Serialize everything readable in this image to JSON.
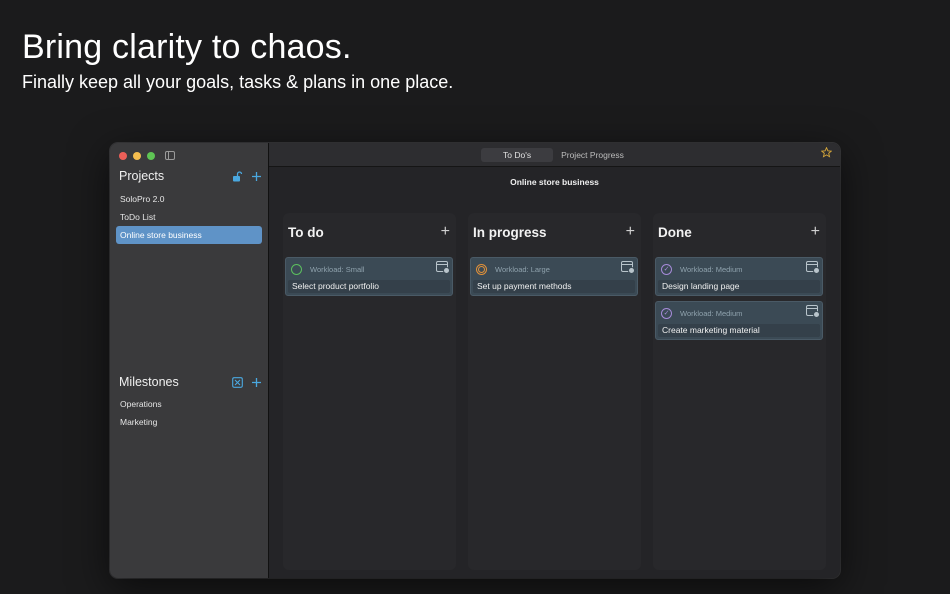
{
  "hero": {
    "title": "Bring clarity to chaos.",
    "subtitle": "Finally keep all your goals, tasks & plans in one place."
  },
  "sidebar": {
    "projects_title": "Projects",
    "projects": [
      {
        "label": "SoloPro 2.0"
      },
      {
        "label": "ToDo List"
      },
      {
        "label": "Online store business"
      }
    ],
    "milestones_title": "Milestones",
    "milestones": [
      {
        "label": "Operations"
      },
      {
        "label": "Marketing"
      }
    ]
  },
  "toolbar": {
    "tabs": [
      {
        "label": "To Do's"
      },
      {
        "label": "Project Progress"
      }
    ]
  },
  "board": {
    "project_title": "Online store business",
    "columns": [
      {
        "title": "To do",
        "cards": [
          {
            "workload": "Workload: Small",
            "label": "Select product portfolio"
          }
        ]
      },
      {
        "title": "In progress",
        "cards": [
          {
            "workload": "Workload: Large",
            "label": "Set up payment methods"
          }
        ]
      },
      {
        "title": "Done",
        "cards": [
          {
            "workload": "Workload: Medium",
            "label": "Design landing page"
          },
          {
            "workload": "Workload: Medium",
            "label": "Create marketing material"
          }
        ]
      }
    ]
  },
  "colors": {
    "accent": "#4aa8e0",
    "selected_item": "#5f93c7",
    "status_todo": "#5bbf5e",
    "status_progress": "#e0913a",
    "status_done": "#a58ad8",
    "favorite_star": "#d7a83a"
  },
  "icons": {
    "projects_actions": [
      "lock-icon",
      "plus-icon"
    ],
    "milestones_actions": [
      "checkbox-x-icon",
      "plus-icon"
    ],
    "card_action": "calendar-icon",
    "favorite": "star-icon"
  }
}
